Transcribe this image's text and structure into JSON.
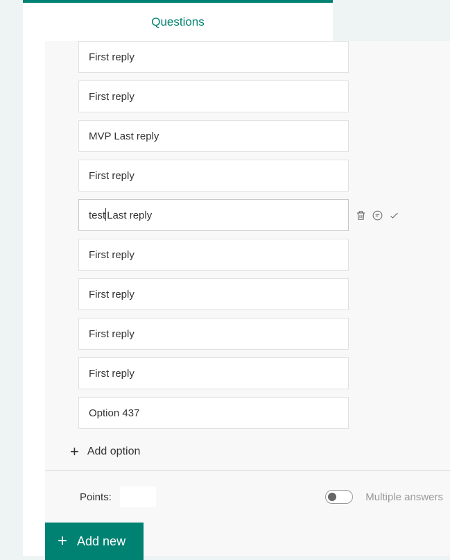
{
  "tab": {
    "title": "Questions"
  },
  "options": [
    {
      "label": "First reply",
      "active": false
    },
    {
      "label": "First reply",
      "active": false
    },
    {
      "label": "MVP Last reply",
      "active": false
    },
    {
      "label": "First reply",
      "active": false
    },
    {
      "prefix": "test",
      "suffix": "Last reply",
      "active": true
    },
    {
      "label": "First reply",
      "active": false
    },
    {
      "label": "First reply",
      "active": false
    },
    {
      "label": "First reply",
      "active": false
    },
    {
      "label": "First reply",
      "active": false
    },
    {
      "label": "Option 437",
      "active": false
    }
  ],
  "add_option_label": "Add option",
  "points_label": "Points:",
  "points_value": "",
  "multiple_answers_label": "Multiple answers",
  "add_new_label": "Add new"
}
